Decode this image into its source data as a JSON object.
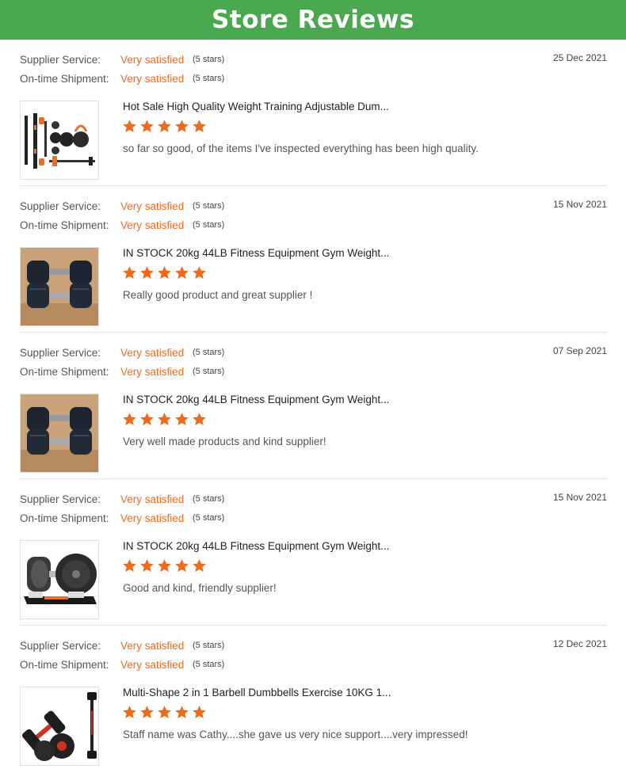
{
  "header": {
    "title": "Store Reviews"
  },
  "colors": {
    "header_bg": "#4aa84e",
    "accent": "#f06a1a",
    "star": "#f06a1a"
  },
  "reviews": [
    {
      "supplier_label": "Supplier Service:",
      "supplier_value": "Very satisfied",
      "supplier_stars": "(5 stars)",
      "shipment_label": "On-time Shipment:",
      "shipment_value": "Very satisfied",
      "shipment_stars": "(5 stars)",
      "date": "25 Dec 2021",
      "product_title": "Hot Sale High Quality Weight Training Adjustable Dum...",
      "rating": 5,
      "comment": "so far so good, of the items I've inspected everything has been high quality.",
      "thumb_icon": "kettlebell-set-icon"
    },
    {
      "supplier_label": "Supplier Service:",
      "supplier_value": "Very satisfied",
      "supplier_stars": "(5 stars)",
      "shipment_label": "On-time Shipment:",
      "shipment_value": "Very satisfied",
      "shipment_stars": "(5 stars)",
      "date": "15 Nov 2021",
      "product_title": "IN STOCK 20kg 44LB Fitness Equipment Gym Weight...",
      "rating": 5,
      "comment": "Really good product and great supplier !",
      "thumb_icon": "adjustable-dumbbell-pair-icon"
    },
    {
      "supplier_label": "Supplier Service:",
      "supplier_value": "Very satisfied",
      "supplier_stars": "(5 stars)",
      "shipment_label": "On-time Shipment:",
      "shipment_value": "Very satisfied",
      "shipment_stars": "(5 stars)",
      "date": "07 Sep 2021",
      "product_title": "IN STOCK 20kg 44LB Fitness Equipment Gym Weight...",
      "rating": 5,
      "comment": "Very well made products and kind supplier!",
      "thumb_icon": "adjustable-dumbbell-pair-icon"
    },
    {
      "supplier_label": "Supplier Service:",
      "supplier_value": "Very satisfied",
      "supplier_stars": "(5 stars)",
      "shipment_label": "On-time Shipment:",
      "shipment_value": "Very satisfied",
      "shipment_stars": "(5 stars)",
      "date": "15 Nov 2021",
      "product_title": "IN STOCK 20kg 44LB Fitness Equipment Gym Weight...",
      "rating": 5,
      "comment": "Good and kind, friendly supplier!",
      "thumb_icon": "dumbbell-on-cradle-icon"
    },
    {
      "supplier_label": "Supplier Service:",
      "supplier_value": "Very satisfied",
      "supplier_stars": "(5 stars)",
      "shipment_label": "On-time Shipment:",
      "shipment_value": "Very satisfied",
      "shipment_stars": "(5 stars)",
      "date": "12 Dec 2021",
      "product_title": "Multi-Shape 2 in 1 Barbell Dumbbells Exercise 10KG 1...",
      "rating": 5,
      "comment": "Staff name was Cathy....she gave us very nice support....very impressed!",
      "thumb_icon": "barbell-dumbbell-set-icon"
    }
  ]
}
